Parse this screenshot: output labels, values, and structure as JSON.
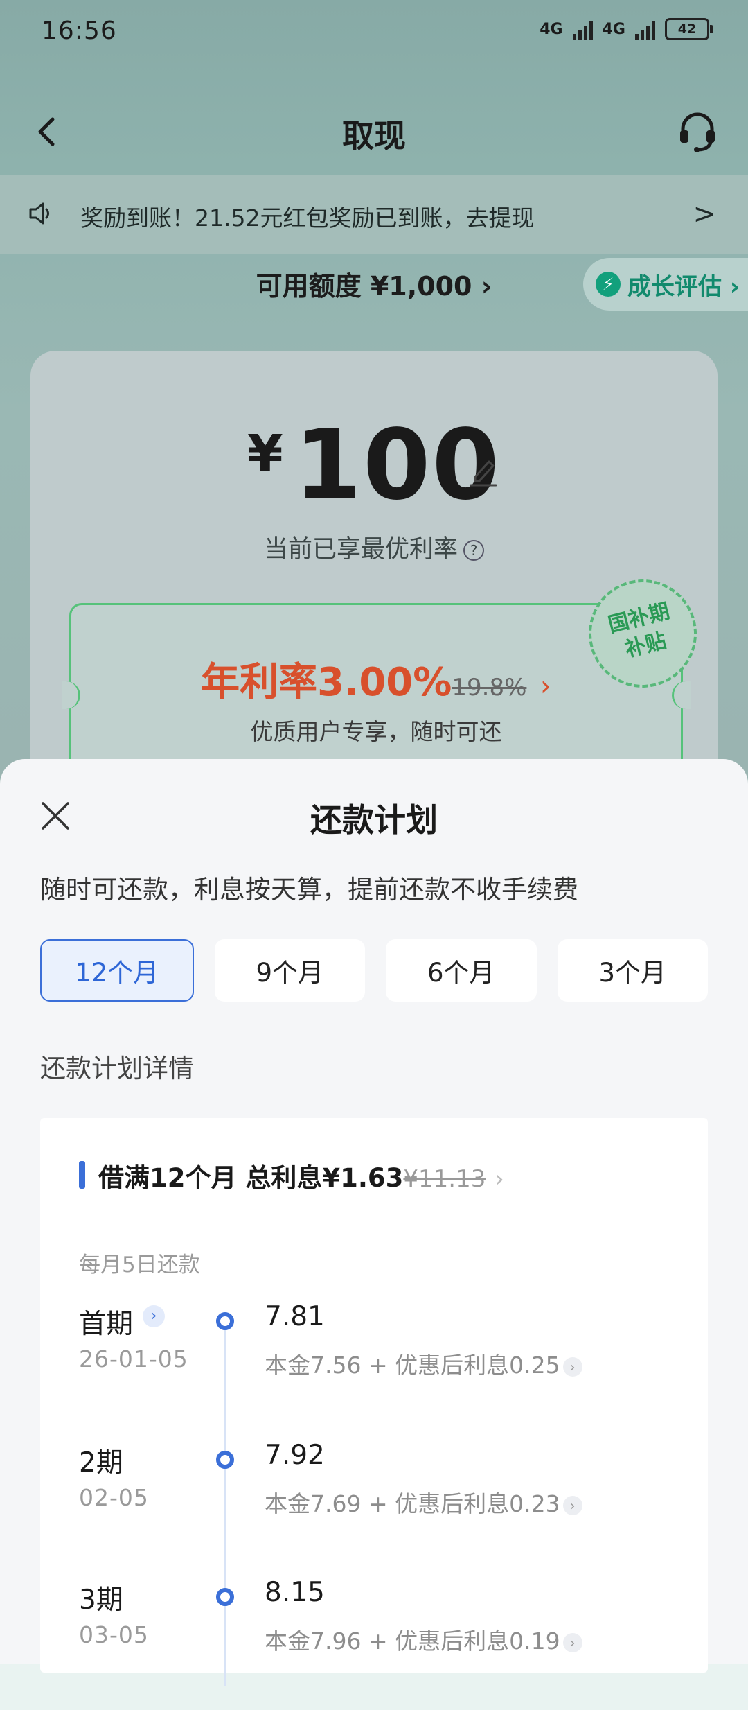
{
  "status": {
    "time": "16:56",
    "network1": "4G",
    "network2": "4G",
    "battery": "42"
  },
  "header": {
    "title": "取现"
  },
  "notice": {
    "text": "奖励到账！21.52元红包奖励已到账，去提现",
    "arrow": ">"
  },
  "quota": {
    "label": "可用额度 ¥1,000 ›"
  },
  "growth": {
    "label": "成长评估 ›"
  },
  "loan": {
    "currency": "¥",
    "amount": "100",
    "best_rate_note": "当前已享最优利率",
    "rate_text": "年利率3.00%",
    "old_rate": "19.8%",
    "chev": "›",
    "rate_sub": "优质用户专享，随时可还",
    "stamp_line1": "国补期",
    "stamp_line2": "补贴"
  },
  "sheet": {
    "title": "还款计划",
    "desc": "随时可还款，利息按天算，提前还款不收手续费",
    "tabs": [
      "12个月",
      "9个月",
      "6个月",
      "3个月"
    ],
    "active_tab": "12个月",
    "section_title": "还款计划详情",
    "plan": {
      "title": "借满12个月 总利息¥1.63",
      "old_interest": "¥11.13",
      "chev": "›",
      "due_day": "每月5日还款",
      "rows": [
        {
          "period": "首期",
          "date": "26-01-05",
          "amount": "7.81",
          "detail": "本金7.56 + 优惠后利息0.25"
        },
        {
          "period": "2期",
          "date": "02-05",
          "amount": "7.92",
          "detail": "本金7.69 + 优惠后利息0.23"
        },
        {
          "period": "3期",
          "date": "03-05",
          "amount": "8.15",
          "detail": "本金7.96 + 优惠后利息0.19"
        }
      ]
    }
  },
  "colors": {
    "accent_blue": "#3b6fd8",
    "rate_red": "#d8502c",
    "brand_green": "#12a07c"
  }
}
